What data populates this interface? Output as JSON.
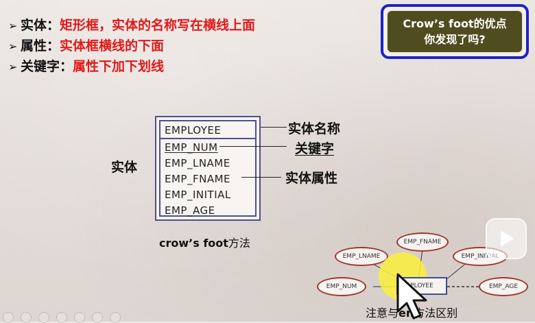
{
  "bullets": [
    {
      "arrow": "➢",
      "term": "实体",
      "colon": "：",
      "desc": "矩形框，实体的名称写在横线上面"
    },
    {
      "arrow": "➢",
      "term": "属性",
      "colon": "：",
      "desc": "实体框横线的下面"
    },
    {
      "arrow": "➢",
      "term": "关键字",
      "colon": "：",
      "desc": "属性下加下划线"
    }
  ],
  "callout": {
    "line1": "Crow’s foot的优点",
    "line2": "你发现了吗?"
  },
  "entity": {
    "name": "EMPLOYEE",
    "attributes": [
      "EMP_NUM",
      "EMP_LNAME",
      "EMP_FNAME",
      "EMP_INITIAL",
      "EMP_AGE"
    ]
  },
  "labels": {
    "left": "实体",
    "entity_name": "实体名称",
    "key": "关键字",
    "attributes": "实体属性"
  },
  "caption": {
    "bold": "crow’s foot",
    "rest": "方法"
  },
  "chen": {
    "entity": "EMPLOYEE",
    "entity_visible": "PLOYEE",
    "ovals": {
      "fname": "EMP_FNAME",
      "lname": "EMP_LNAME",
      "initial": "EMP_INITIAL",
      "num": "EMP_NUM",
      "age": "EMP_AGE"
    }
  },
  "note": {
    "before": "注意与",
    "bold": "en",
    "after": "方法区别"
  },
  "colors": {
    "accent_red": "#e01919",
    "callout_border": "#1c23c6",
    "callout_fill": "#4f4d1f",
    "entity_border": "#4a4f93"
  }
}
